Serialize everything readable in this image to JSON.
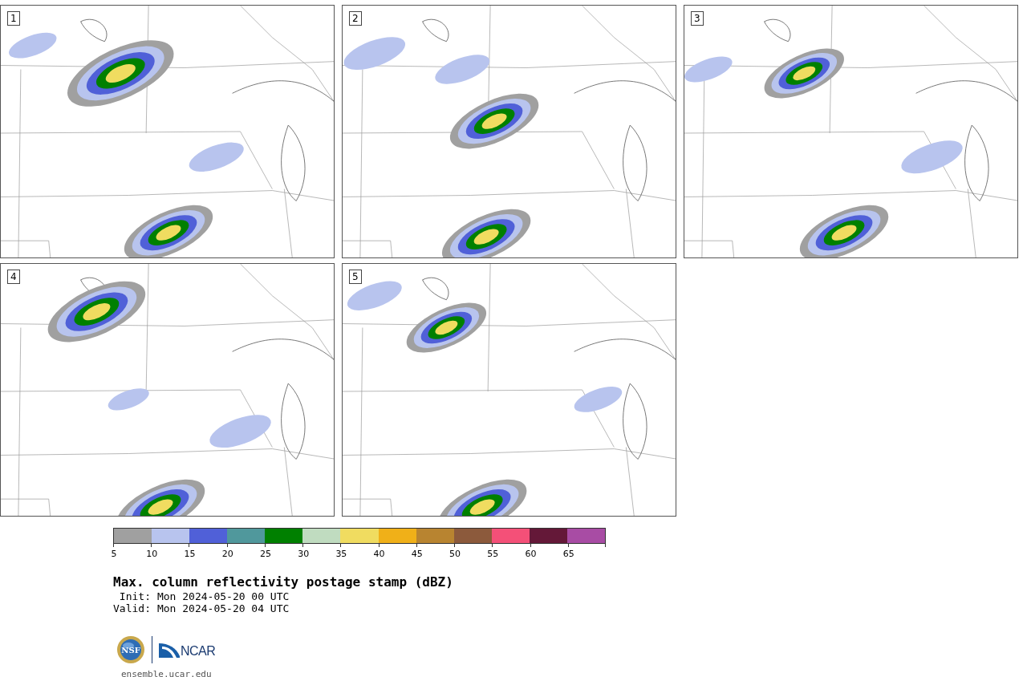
{
  "panels": [
    {
      "label": "1"
    },
    {
      "label": "2"
    },
    {
      "label": "3"
    },
    {
      "label": "4"
    },
    {
      "label": "5"
    }
  ],
  "colorbar": {
    "bins": [
      {
        "color": "#a0a0a0"
      },
      {
        "color": "#b8c4ee"
      },
      {
        "color": "#5060d8"
      },
      {
        "color": "#50989c"
      },
      {
        "color": "#008000"
      },
      {
        "color": "#c0dcc0"
      },
      {
        "color": "#f0dc60"
      },
      {
        "color": "#f0b018"
      },
      {
        "color": "#b88430"
      },
      {
        "color": "#8c5a3c"
      },
      {
        "color": "#f45078"
      },
      {
        "color": "#641838"
      },
      {
        "color": "#a84ca4"
      }
    ],
    "ticks": [
      "5",
      "10",
      "15",
      "20",
      "25",
      "30",
      "35",
      "40",
      "45",
      "50",
      "55",
      "60",
      "65"
    ]
  },
  "title": "Max. column reflectivity postage stamp (dBZ)",
  "times": [
    {
      "label": "Init:",
      "value": "Mon 2024-05-20 00 UTC"
    },
    {
      "label": "Valid:",
      "value": "Mon 2024-05-20 04 UTC"
    }
  ],
  "logos": {
    "nsf": "NSF",
    "ncar": "NCAR",
    "url": "ensemble.ucar.edu"
  }
}
